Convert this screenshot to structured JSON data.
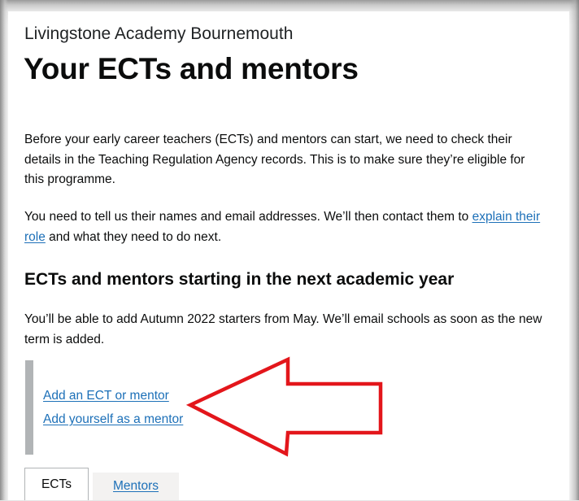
{
  "school_name": "Livingstone Academy Bournemouth",
  "page_title": "Your ECTs and mentors",
  "intro_paragraph_1": "Before your early career teachers (ECTs) and mentors can start, we need to check their details in the Teaching Regulation Agency records. This is to make sure they’re eligible for this programme.",
  "intro_paragraph_2": {
    "before_link": "You need to tell us their names and email addresses. We’ll then contact them to ",
    "link_text": "explain their role",
    "after_link": " and what they need to do next."
  },
  "next_year_section": {
    "heading": "ECTs and mentors starting in the next academic year",
    "text": "You’ll be able to add Autumn 2022 starters from May. We’ll email schools as soon as the new term is added."
  },
  "actions": {
    "add_ect_or_mentor": "Add an ECT or mentor",
    "add_yourself_as_mentor": "Add yourself as a mentor"
  },
  "tabs": [
    {
      "label": "ECTs",
      "selected": true
    },
    {
      "label": "Mentors",
      "selected": false
    }
  ],
  "colors": {
    "link": "#1d70b8",
    "text": "#0b0c0c",
    "inset_border": "#b1b4b6",
    "annotation_arrow": "#e3161b"
  },
  "annotation": {
    "icon": "red-arrow-icon",
    "points_to": "add_ect_or_mentor"
  }
}
